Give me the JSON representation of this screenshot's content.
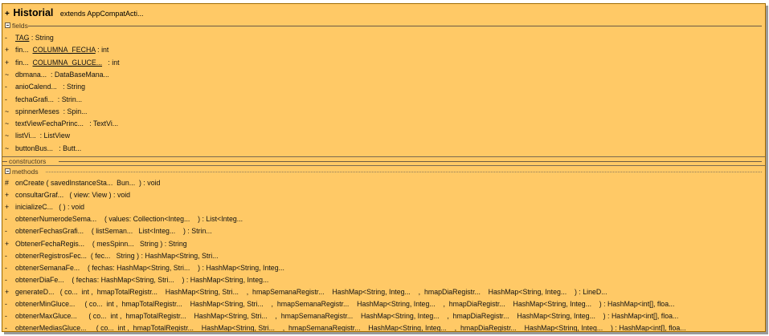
{
  "class": {
    "visibility": "+",
    "name": "Historial",
    "extends_text": "extends AppCompatActi..."
  },
  "sections": {
    "fields": "fields",
    "constructors": "constructors",
    "methods": "methods"
  },
  "fields": [
    {
      "vis": "-",
      "text": "TAG",
      "tail": " : String"
    },
    {
      "vis": "+",
      "pre": "fin...  ",
      "text": "COLUMNA_FECHA",
      "tail": " : int"
    },
    {
      "vis": "+",
      "pre": "fin...  ",
      "text": "COLUMNA_GLUCE...",
      "tail": "   : int"
    },
    {
      "vis": "~",
      "text": "dbmana...  : DataBaseMana..."
    },
    {
      "vis": "-",
      "text": "anioCalend...   : String"
    },
    {
      "vis": "-",
      "text": "fechaGrafi...  : Strin..."
    },
    {
      "vis": "~",
      "text": "spinnerMeses  : Spin..."
    },
    {
      "vis": "~",
      "text": "textViewFechaPrinc...   : TextVi..."
    },
    {
      "vis": "~",
      "text": "listVi...  : ListView"
    },
    {
      "vis": "~",
      "text": "buttonBus...   : Butt..."
    }
  ],
  "methods": [
    {
      "vis": "#",
      "text": "onCreate ( savedInstanceSta...  Bun...  ) : void"
    },
    {
      "vis": "+",
      "text": "consultarGraf...   ( view: View ) : void"
    },
    {
      "vis": "+",
      "text": "inicializeC...   ( ) : void"
    },
    {
      "vis": "-",
      "text": "obtenerNumerodeSema...    ( values: Collection<Integ...    ) : List<Integ..."
    },
    {
      "vis": "-",
      "text": "obtenerFechasGrafi...    ( listSeman...   List<Integ...    ) : Strin..."
    },
    {
      "vis": "+",
      "text": "ObtenerFechaRegis...    ( mesSpinn...   String ) : String"
    },
    {
      "vis": "-",
      "text": "obtenerRegistrosFec...  ( fec...   String ) : HashMap<String, Stri..."
    },
    {
      "vis": "-",
      "text": "obtenerSemanaFe...    ( fechas: HashMap<String, Stri...    ) : HashMap<String, Integ..."
    },
    {
      "vis": "-",
      "text": "obtenerDiaFe...    ( fechas: HashMap<String, Stri...    ) : HashMap<String, Integ..."
    },
    {
      "vis": "+",
      "text": "generateD...   ( co...  int ,  hmapTotalRegistr...    HashMap<String, Stri...    ,  hmapSemanaRegistr...    HashMap<String, Integ...    ,  hmapDiaRegistr...    HashMap<String, Integ...    ) : LineD..."
    },
    {
      "vis": "-",
      "text": "obtenerMinGluce...     ( co...  int ,  hmapTotalRegistr...    HashMap<String, Stri...    ,  hmapSemanaRegistr...    HashMap<String, Integ...    ,  hmapDiaRegistr...    HashMap<String, Integ...    ) : HashMap<int[], floa..."
    },
    {
      "vis": "-",
      "text": "obtenerMaxGluce...      ( co...  int ,  hmapTotalRegistr...    HashMap<String, Stri...    ,  hmapSemanaRegistr...    HashMap<String, Integ...    ,  hmapDiaRegistr...    HashMap<String, Integ...    ) : HashMap<int[], floa..."
    },
    {
      "vis": "-",
      "text": "obtenerMediasGluce...     ( co...  int ,  hmapTotalRegistr...    HashMap<String, Stri...    ,  hmapSemanaRegistr...    HashMap<String, Integ...    ,  hmapDiaRegistr...    HashMap<String, Integ...    ) : HashMap<int[], floa..."
    }
  ]
}
